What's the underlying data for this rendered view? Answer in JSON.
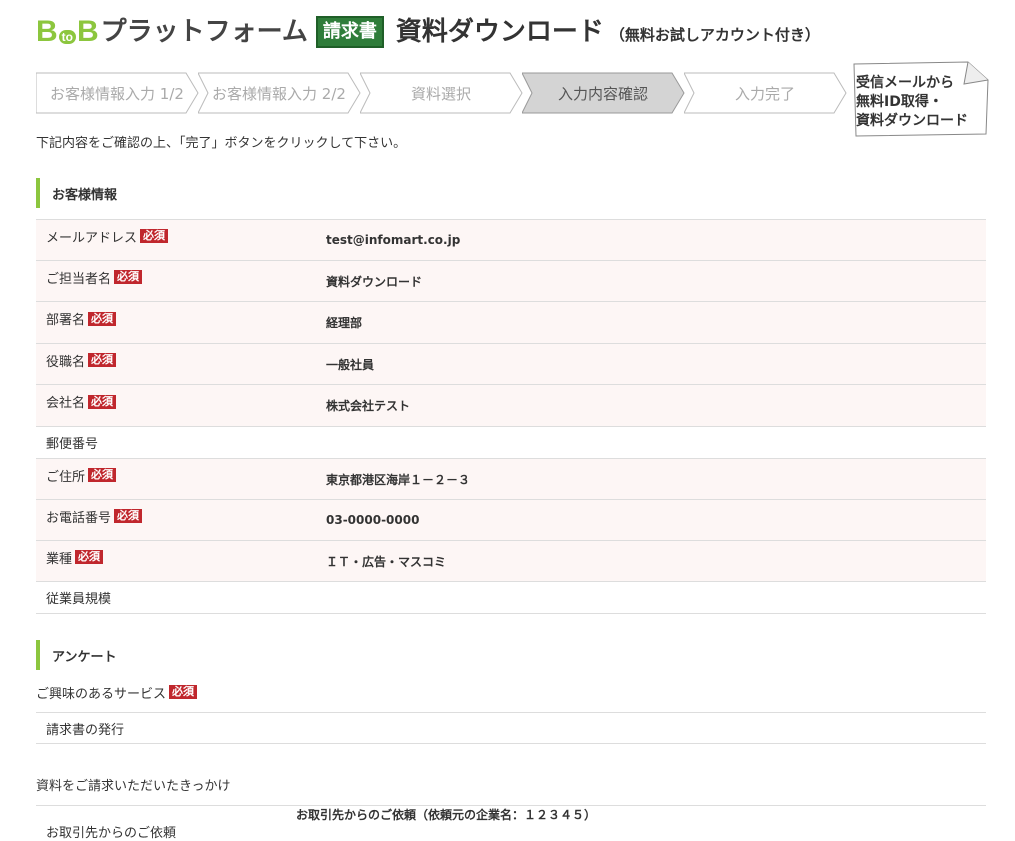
{
  "header": {
    "logo_b1": "B",
    "logo_to": "to",
    "logo_b2": "B",
    "logo_name": "プラットフォーム",
    "badge": "請求書",
    "title": "資料ダウンロード",
    "subtitle": "（無料お試しアカウント付き）"
  },
  "steps": [
    {
      "label": "お客様情報入力 1/2",
      "active": false
    },
    {
      "label": "お客様情報入力 2/2",
      "active": false
    },
    {
      "label": "資料選択",
      "active": false
    },
    {
      "label": "入力内容確認",
      "active": true
    },
    {
      "label": "入力完了",
      "active": false
    }
  ],
  "callout": {
    "text": "受信メールから\n無料ID取得・\n資料ダウンロード"
  },
  "instruction": "下記内容をご確認の上、「完了」ボタンをクリックして下さい。",
  "customer": {
    "heading": "お客様情報",
    "required_badge": "必須",
    "rows": [
      {
        "label": "メールアドレス",
        "required": true,
        "value": "test@infomart.co.jp"
      },
      {
        "label": "ご担当者名",
        "required": true,
        "value": "資料ダウンロード"
      },
      {
        "label": "部署名",
        "required": true,
        "value": "経理部"
      },
      {
        "label": "役職名",
        "required": true,
        "value": "一般社員"
      },
      {
        "label": "会社名",
        "required": true,
        "value": "株式会社テスト"
      },
      {
        "label": "郵便番号",
        "required": false,
        "value": ""
      },
      {
        "label": "ご住所",
        "required": true,
        "value": "東京都港区海岸１－２－３"
      },
      {
        "label": "お電話番号",
        "required": true,
        "value": "03-0000-0000"
      },
      {
        "label": "業種",
        "required": true,
        "value": "ＩＴ・広告・マスコミ"
      },
      {
        "label": "従業員規模",
        "required": false,
        "value": ""
      }
    ]
  },
  "survey": {
    "heading": "アンケート",
    "interest_label": "ご興味のあるサービス",
    "interest_badge": "必須",
    "interest_value": "請求書の発行",
    "trigger_label": "資料をご請求いただいたきっかけ",
    "trigger_option": "お取引先からのご依頼",
    "trigger_value": "お取引先からのご依頼（依頼元の企業名：１２３４５）"
  }
}
